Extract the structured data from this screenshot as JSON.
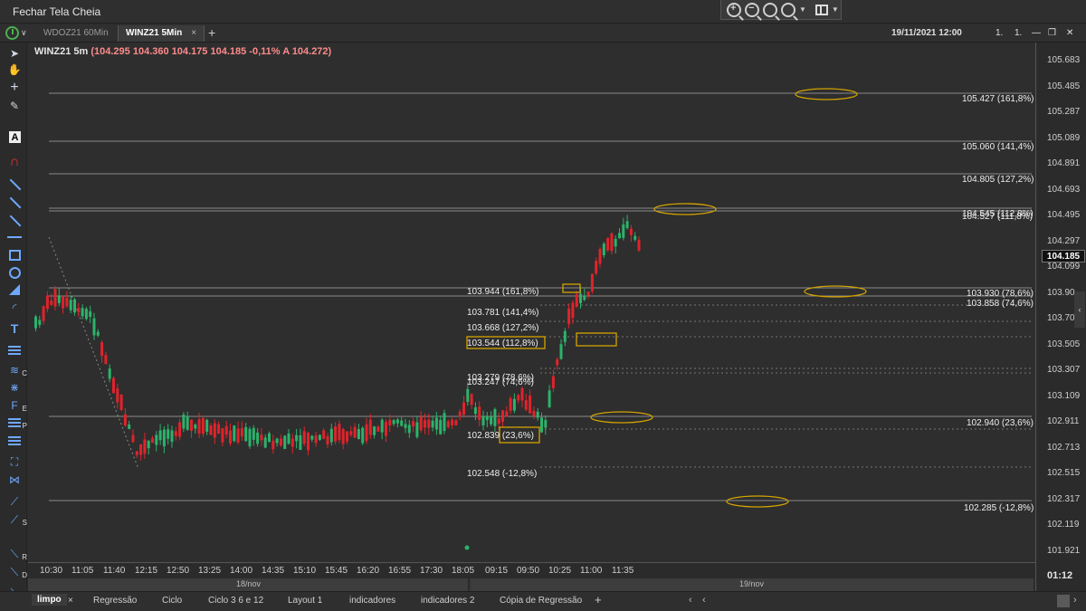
{
  "window": {
    "title": "Fechar Tela Cheia"
  },
  "tabs": [
    {
      "label": "WDOZ21 60Min",
      "active": false
    },
    {
      "label": "WINZ21 5Min",
      "active": true
    }
  ],
  "tabbar_right": {
    "datetime": "19/11/2021 12:00",
    "b1": "1.",
    "b2": "1."
  },
  "header": {
    "symbol": "WINZ21 5m",
    "quote": "(104.295  104.360  104.175  104.185  -0,11%  A 104.272)"
  },
  "price_axis": {
    "current_price": "104.185",
    "labels": [
      "105.683",
      "105.485",
      "105.287",
      "105.089",
      "104.891",
      "104.693",
      "104.495",
      "104.297",
      "104.099",
      "103.90",
      "103.70",
      "103.505",
      "103.307",
      "103.109",
      "102.911",
      "102.713",
      "102.515",
      "102.317",
      "102.119",
      "101.921"
    ]
  },
  "time_axis": {
    "labels": [
      "10:30",
      "11:05",
      "11:40",
      "12:15",
      "12:50",
      "13:25",
      "14:00",
      "14:35",
      "15:10",
      "15:45",
      "16:20",
      "16:55",
      "17:30",
      "18:05",
      "09:15",
      "09:50",
      "10:25",
      "11:00",
      "11:35"
    ],
    "dates": [
      "18/nov",
      "19/nov"
    ],
    "countdown": "01:12"
  },
  "levels_right": [
    {
      "label": "105.427 (161,8%)"
    },
    {
      "label": "105.060 (141,4%)"
    },
    {
      "label": "104.805 (127,2%)"
    },
    {
      "label": "104.545 (112,8%)"
    },
    {
      "label": "104.527 (111,8%)"
    },
    {
      "label": "103.930 (78,6%)"
    },
    {
      "label": "103.858 (74,6%)"
    },
    {
      "label": "102.940 (23,6%)"
    },
    {
      "label": "102.285 (-12,8%)"
    }
  ],
  "levels_mid": [
    {
      "label": "103.944 (161,8%)"
    },
    {
      "label": "103.781 (141,4%)"
    },
    {
      "label": "103.668 (127,2%)"
    },
    {
      "label": "103.544 (112,8%)"
    },
    {
      "label": "103.279 (78,6%)"
    },
    {
      "label": "103.247 (74,6%)"
    },
    {
      "label": "102.839 (23,6%)"
    },
    {
      "label": "102.548 (-12,8%)"
    }
  ],
  "bottom_tabs": [
    "limpo",
    "Regressão",
    "Ciclo",
    "Ciclo 3 6 e 12",
    "Layout 1",
    "indicadores",
    "indicadores 2",
    "Cópia de Regressão"
  ],
  "colors": {
    "up": "#2bb36b",
    "down": "#e0232b",
    "highlight": "#d4a400",
    "bg": "#2e2e2e"
  },
  "icons": [
    "cursor-icon",
    "hand-icon",
    "crosshair-icon",
    "pencil-icon",
    "text-font-icon",
    "magnet-icon",
    "trend-line-icon",
    "rectangle-icon",
    "circle-icon",
    "triangle-icon",
    "fibonacci-icon",
    "zoom-in-icon",
    "zoom-out-icon",
    "layout-icon",
    "clock-icon"
  ]
}
